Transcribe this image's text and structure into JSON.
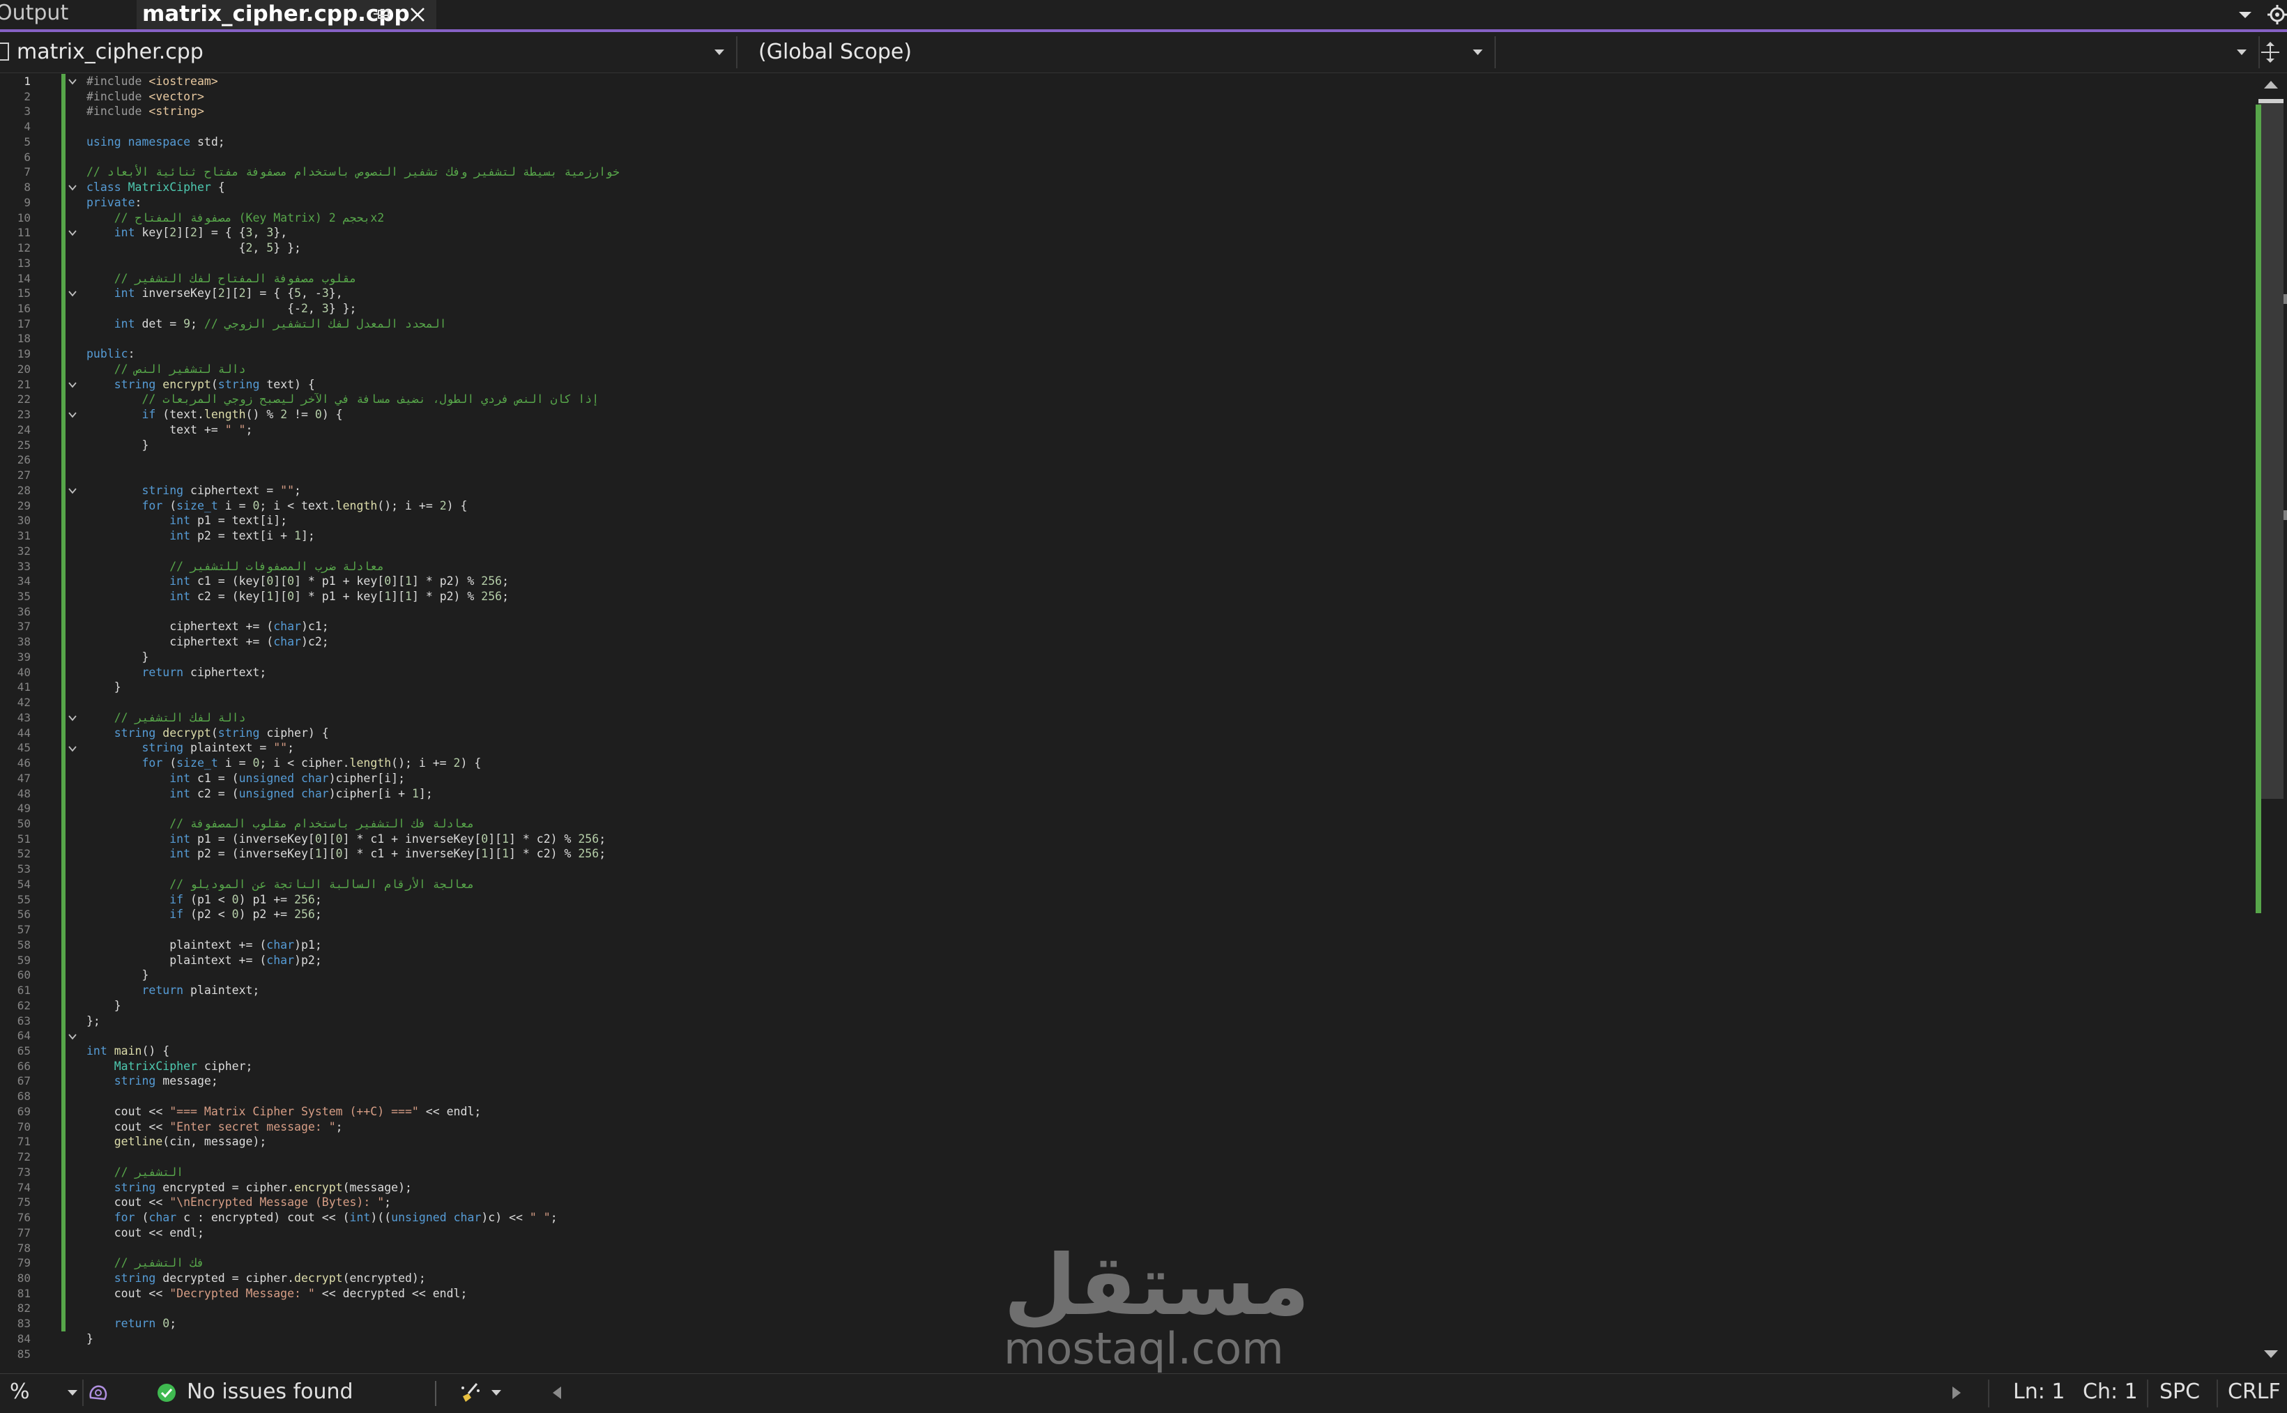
{
  "tabs": {
    "output_label": "Output",
    "active_label": "matrix_cipher.cpp.cpp"
  },
  "nav": {
    "file": "matrix_cipher.cpp",
    "scope": "(Global Scope)",
    "member": ""
  },
  "colors": {
    "keyword": "#569cd6",
    "type": "#4ec9b0",
    "comment": "#57a64a",
    "string": "#d69d85",
    "preproc": "#9b9b9b",
    "include_path": "#e8c9a0",
    "number": "#b5cea8",
    "variable": "#9cdcfe",
    "function": "#dcdcaa",
    "accent": "#8661c5"
  },
  "editor": {
    "current_line": 1,
    "code": [
      "#include <iostream>",
      "#include <vector>",
      "#include <string>",
      "",
      "using namespace std;",
      "",
      "// خوارزمية بسيطة لتشفير وفك تشفير النصوص باستخدام مصفوفة مفتاح ثنائية الأبعاد",
      "class MatrixCipher {",
      "private:",
      "    // مصفوفة المفتاح (Key Matrix) بحجم 2x2",
      "    int key[2][2] = { {3, 3},",
      "                      {2, 5} };",
      "",
      "    // مقلوب مصفوفة المفتاح لفك التشفير",
      "    int inverseKey[2][2] = { {5, -3},",
      "                             {-2, 3} };",
      "    int det = 9; // المحدد المعدل لفك التشفير الزوجي",
      "",
      "public:",
      "    // دالة لتشفير النص",
      "    string encrypt(string text) {",
      "        // إذا كان النص فردي الطول، نضيف مسافة في الآخر ليصبح زوجي المربعات",
      "        if (text.length() % 2 != 0) {",
      "            text += \" \";",
      "        }",
      "",
      "",
      "        string ciphertext = \"\";",
      "        for (size_t i = 0; i < text.length(); i += 2) {",
      "            int p1 = text[i];",
      "            int p2 = text[i + 1];",
      "",
      "            // معادلة ضرب المصفوفات للتشفير",
      "            int c1 = (key[0][0] * p1 + key[0][1] * p2) % 256;",
      "            int c2 = (key[1][0] * p1 + key[1][1] * p2) % 256;",
      "",
      "            ciphertext += (char)c1;",
      "            ciphertext += (char)c2;",
      "        }",
      "        return ciphertext;",
      "    }",
      "",
      "    // دالة لفك التشفير",
      "    string decrypt(string cipher) {",
      "        string plaintext = \"\";",
      "        for (size_t i = 0; i < cipher.length(); i += 2) {",
      "            int c1 = (unsigned char)cipher[i];",
      "            int c2 = (unsigned char)cipher[i + 1];",
      "",
      "            // معادلة فك التشفير باستخدام مقلوب المصفوفة",
      "            int p1 = (inverseKey[0][0] * c1 + inverseKey[0][1] * c2) % 256;",
      "            int p2 = (inverseKey[1][0] * c1 + inverseKey[1][1] * c2) % 256;",
      "",
      "            // معالجة الأرقام السالبة الناتجة عن الموديلو",
      "            if (p1 < 0) p1 += 256;",
      "            if (p2 < 0) p2 += 256;",
      "",
      "            plaintext += (char)p1;",
      "            plaintext += (char)p2;",
      "        }",
      "        return plaintext;",
      "    }",
      "};",
      "",
      "int main() {",
      "    MatrixCipher cipher;",
      "    string message;",
      "",
      "    cout << \"=== Matrix Cipher System (++C) ===\" << endl;",
      "    cout << \"Enter secret message: \";",
      "    getline(cin, message);",
      "",
      "    // التشفير",
      "    string encrypted = cipher.encrypt(message);",
      "    cout << \"\\nEncrypted Message (Bytes): \";",
      "    for (char c : encrypted) cout << (int)((unsigned char)c) << \" \";",
      "    cout << endl;",
      "",
      "    // فك التشفير",
      "    string decrypted = cipher.decrypt(encrypted);",
      "    cout << \"Decrypted Message: \" << decrypted << endl;",
      "",
      "    return 0;",
      "}",
      ""
    ],
    "fold_lines": [
      1,
      8,
      11,
      15,
      21,
      23,
      28,
      43,
      45,
      64
    ]
  },
  "watermark": {
    "arabic": "مستقل",
    "latin": "mostaql.com"
  },
  "status": {
    "zoom": "%",
    "issues": "No issues found",
    "line": "Ln: 1",
    "char": "Ch: 1",
    "whitespace": "SPC",
    "line_ending": "CRLF"
  }
}
